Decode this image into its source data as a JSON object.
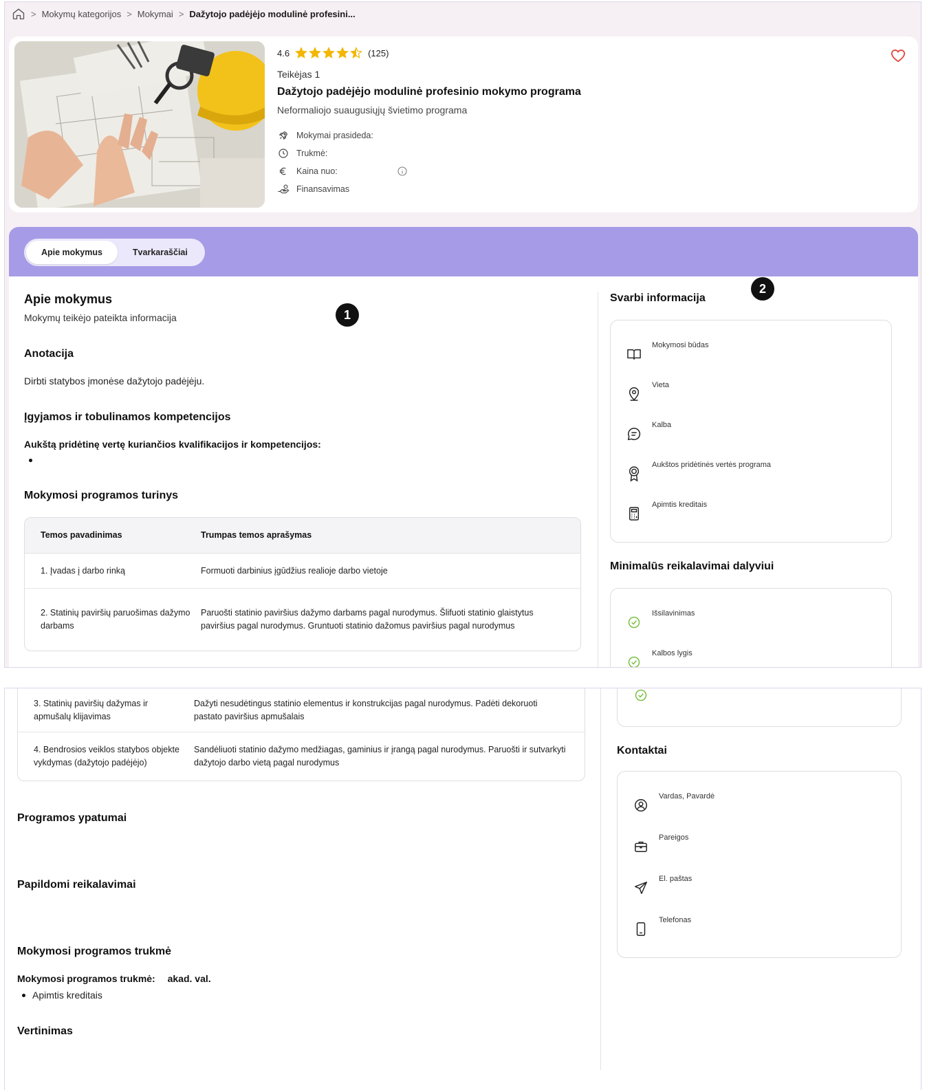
{
  "breadcrumb": {
    "items": [
      "Mokymų kategorijos",
      "Mokymai"
    ],
    "current": "Dažytojo padėjėjo modulinė profesini..."
  },
  "course": {
    "rating": "4.6",
    "stars_filled": 4.5,
    "reviews": "(125)",
    "provider": "Teikėjas 1",
    "title": "Dažytojo padėjėjo modulinė profesinio mokymo programa",
    "subtitle": "Neformaliojo suaugusiųjų švietimo programa",
    "meta": [
      {
        "icon": "rocket-icon",
        "label": "Mokymai prasideda:"
      },
      {
        "icon": "clock-icon",
        "label": "Trukmė:"
      },
      {
        "icon": "euro-icon",
        "label": "Kaina nuo:"
      },
      {
        "icon": "hand-coins-icon",
        "label": "Finansavimas"
      }
    ],
    "accent_color": "#f2b705",
    "heart_color": "#e2483d"
  },
  "tabs": [
    {
      "label": "Apie mokymus",
      "active": true
    },
    {
      "label": "Tvarkaraščiai",
      "active": false
    }
  ],
  "about": {
    "heading": "Apie mokymus",
    "note": "Mokymų teikėjo pateikta informacija",
    "annotation_h": "Anotacija",
    "annotation": "Dirbti statybos įmonėse dažytojo padėjėju.",
    "competences_h": "Įgyjamos ir tobulinamos kompetencijos",
    "competences_sub": "Aukštą pridėtinę vertę kuriančios kvalifikacijos ir kompetencijos:",
    "content_h": "Mokymosi programos turinys"
  },
  "table": {
    "headers": [
      "Temos pavadinimas",
      "Trumpas temos aprašymas"
    ],
    "rows": [
      [
        "1. Įvadas į darbo rinką",
        "Formuoti darbinius įgūdžius realioje darbo vietoje"
      ],
      [
        "2. Statinių paviršių paruošimas dažymo darbams",
        "Paruošti statinio paviršius dažymo darbams pagal nurodymus. Šlifuoti statinio glaistytus paviršius pagal nurodymus. Gruntuoti statinio dažomus paviršius pagal nurodymus"
      ],
      [
        "3. Statinių paviršių dažymas ir apmušalų klijavimas",
        "Dažyti nesudėtingus statinio elementus ir konstrukcijas pagal nurodymus. Padėti dekoruoti pastato paviršius apmušalais"
      ],
      [
        "4. Bendrosios veiklos statybos objekte vykdymas (dažytojo padėjėjo)",
        "Sandėliuoti statinio dažymo medžiagas, gaminius ir įrangą pagal nurodymus. Paruošti ir sutvarkyti dažytojo darbo vietą pagal nurodymus"
      ]
    ]
  },
  "sections2": {
    "features_h": "Programos ypatumai",
    "extra_req_h": "Papildomi reikalavimai",
    "duration_h": "Mokymosi programos trukmė",
    "duration_label": "Mokymosi programos trukmė:",
    "duration_unit": "akad. val.",
    "duration_bullet": "Apimtis kreditais",
    "evaluation_h": "Vertinimas"
  },
  "important": {
    "heading": "Svarbi informacija",
    "items": [
      {
        "icon": "book-open-icon",
        "label": "Mokymosi būdas"
      },
      {
        "icon": "map-pin-icon",
        "label": "Vieta"
      },
      {
        "icon": "chat-bubble-icon",
        "label": "Kalba"
      },
      {
        "icon": "award-icon",
        "label": "Aukštos pridėtinės vertės programa"
      },
      {
        "icon": "calculator-icon",
        "label": "Apimtis kreditais"
      }
    ]
  },
  "requirements": {
    "heading": "Minimalūs reikalavimai dalyviui",
    "items": [
      {
        "icon": "check-circle-icon",
        "label": "Išsilavinimas"
      },
      {
        "icon": "check-circle-icon",
        "label": "Kalbos lygis"
      }
    ],
    "check_color": "#7bc043"
  },
  "contacts": {
    "heading": "Kontaktai",
    "items": [
      {
        "icon": "user-circle-icon",
        "label": "Vardas, Pavardė"
      },
      {
        "icon": "briefcase-icon",
        "label": "Pareigos"
      },
      {
        "icon": "send-icon",
        "label": "El. paštas"
      },
      {
        "icon": "phone-icon",
        "label": "Telefonas"
      }
    ]
  },
  "markers": [
    "1",
    "2"
  ],
  "colors": {
    "tab_bar": "#a69be6",
    "panel_bg": "#f6eff4"
  }
}
